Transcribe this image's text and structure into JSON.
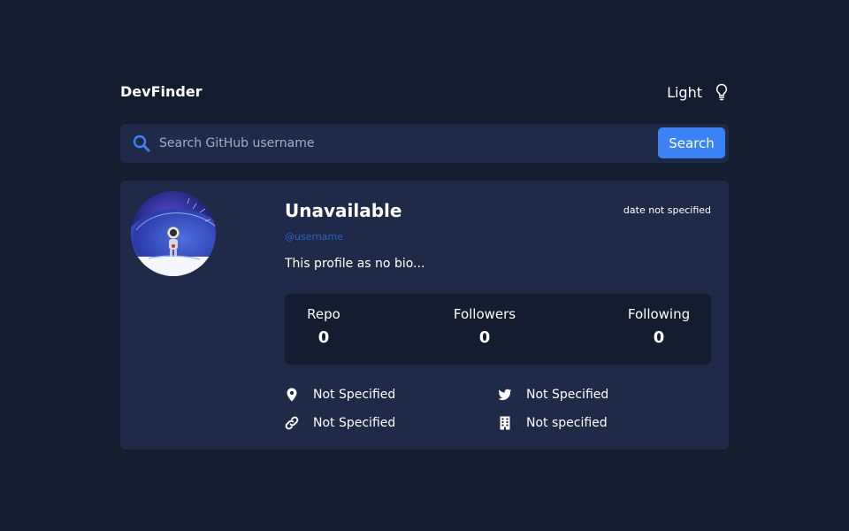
{
  "header": {
    "title": "DevFinder",
    "theme_label": "Light"
  },
  "search": {
    "placeholder": "Search GitHub username",
    "value": "",
    "button_label": "Search"
  },
  "profile": {
    "name": "Unavailable",
    "login": "@username",
    "joined": "date not specified",
    "bio": "This profile as no bio...",
    "stats": [
      {
        "label": "Repo",
        "value": "0"
      },
      {
        "label": "Followers",
        "value": "0"
      },
      {
        "label": "Following",
        "value": "0"
      }
    ],
    "links": {
      "location": "Not Specified",
      "blog": "Not Specified",
      "twitter": "Not Specified",
      "company": "Not specified"
    }
  },
  "icons": {
    "theme": "lightbulb-icon",
    "search": "search-icon",
    "location": "location-pin-icon",
    "blog": "link-icon",
    "twitter": "twitter-icon",
    "company": "building-icon"
  },
  "colors": {
    "background": "#141c2f",
    "card": "#1f2a48",
    "accent": "#3b82f6",
    "username_link": "#2b61c2",
    "placeholder": "#a3adc2"
  }
}
